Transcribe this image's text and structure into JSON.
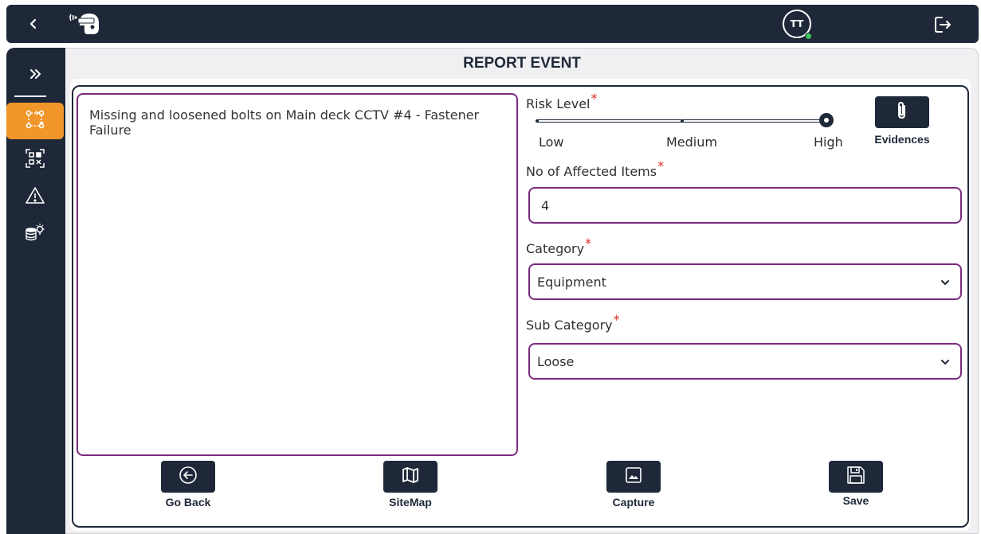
{
  "app": {
    "avatar_initials": "TT",
    "status_color": "#3cc45a",
    "brand_dark": "#1e2838",
    "accent_orange": "#f0962a",
    "field_border": "#7b2a7f",
    "icons": {
      "back": "chevron-left-icon",
      "logo": "helmet-signal-logo",
      "logout": "logout-icon"
    }
  },
  "sidebar": {
    "items": [
      {
        "name": "expand",
        "icon": "double-chevron-right-icon",
        "active": false
      },
      {
        "name": "workflow",
        "icon": "workflow-nodes-icon",
        "active": true
      },
      {
        "name": "qr-scan",
        "icon": "qr-code-icon",
        "active": false
      },
      {
        "name": "warning",
        "icon": "warning-triangle-icon",
        "active": false
      },
      {
        "name": "ideas",
        "icon": "coins-lightbulb-icon",
        "active": false
      }
    ]
  },
  "page": {
    "title": "REPORT EVENT"
  },
  "form": {
    "description": "Missing and loosened bolts on Main deck CCTV #4 - Fastener Failure",
    "risk_level": {
      "label": "Risk Level",
      "required_mark": "*",
      "options": [
        "Low",
        "Medium",
        "High"
      ],
      "selected": "High"
    },
    "evidences": {
      "label": "Evidences",
      "icon": "paperclip-icon"
    },
    "affected_items": {
      "label": "No of Affected Items",
      "required_mark": "*",
      "value": "4"
    },
    "category": {
      "label": "Category",
      "required_mark": "*",
      "value": "Equipment"
    },
    "sub_category": {
      "label": "Sub Category",
      "required_mark": "*",
      "value": "Loose"
    }
  },
  "actions": [
    {
      "name": "go-back",
      "label": "Go Back",
      "icon": "circle-arrow-left-icon"
    },
    {
      "name": "sitemap",
      "label": "SiteMap",
      "icon": "map-icon"
    },
    {
      "name": "capture",
      "label": "Capture",
      "icon": "image-icon"
    },
    {
      "name": "save",
      "label": "Save",
      "icon": "floppy-disk-icon"
    }
  ]
}
